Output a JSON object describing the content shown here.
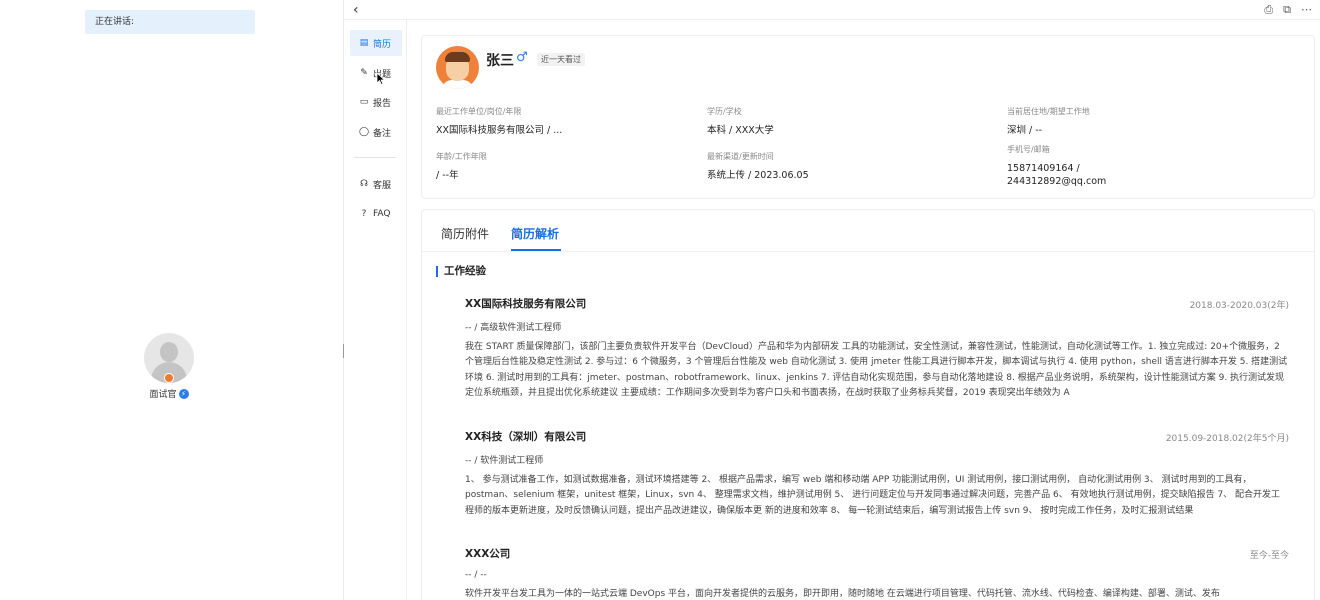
{
  "left_panel": {
    "speaking_label": "正在讲话:",
    "interviewer_label": "面试官",
    "role_badge": "⚡"
  },
  "topbar": {
    "back_icon": "‹",
    "actions": [
      "⎙",
      "⧉",
      "⋯"
    ]
  },
  "nav": {
    "items": [
      {
        "label": "简历",
        "icon": "▤"
      },
      {
        "label": "出题",
        "icon": "✎"
      },
      {
        "label": "报告",
        "icon": "▭"
      },
      {
        "label": "备注",
        "icon": "◯"
      },
      {
        "label": "客服",
        "icon": "☊"
      },
      {
        "label": "FAQ",
        "icon": "?"
      }
    ]
  },
  "candidate": {
    "name": "张三",
    "gender_icon": "♂",
    "seen_badge": "近一天看过",
    "fields": [
      {
        "label": "最近工作单位/岗位/年限",
        "value": "XX国际科技服务有限公司 / ..."
      },
      {
        "label": "学历/学校",
        "value": "本科 / XXX大学"
      },
      {
        "label": "当前居住地/期望工作地",
        "value": "深圳 / --"
      },
      {
        "label": "年龄/工作年限",
        "value": "/ --年"
      },
      {
        "label": "最新渠道/更新时间",
        "value": "系统上传 / 2023.06.05"
      },
      {
        "label": "手机号/邮箱",
        "value": "15871409164 /",
        "value2": "244312892@qq.com"
      }
    ]
  },
  "resume": {
    "tabs": [
      "简历附件",
      "简历解析"
    ],
    "section_title": "工作经验",
    "jobs": [
      {
        "company": "XX国际科技服务有限公司",
        "period": "2018.03-2020.03(2年)",
        "role": "-- / 高级软件测试工程师",
        "desc": "我在 START 质量保障部门，该部门主要负责软件开发平台（DevCloud）产品和华为内部研发 工具的功能测试，安全性测试，兼容性测试，性能测试，自动化测试等工作。1. 独立完成过: 20+个微服务，2 个管理后台性能及稳定性测试 2. 参与过：6 个微服务，3 个管理后台性能及 web 自动化测试 3. 使用 jmeter 性能工具进行脚本开发，脚本调试与执行 4. 使用 python，shell 语言进行脚本开发 5. 搭建测试环境 6. 测试时用到的工具有：jmeter、postman、robotframework、linux、jenkins 7. 评估自动化实现范围，参与自动化落地建设 8. 根据产品业务说明，系统架构，设计性能测试方案 9. 执行测试发现定位系统瓶颈，并且提出优化系统建议 主要成绩：工作期间多次受到华为客户口头和书面表扬，在战时获取了业务标兵奖督，2019 表现突出年绩效为 A"
      },
      {
        "company": "XX科技（深圳）有限公司",
        "period": "2015.09-2018.02(2年5个月)",
        "role": "-- / 软件测试工程师",
        "desc": "1、 参与测试准备工作，如测试数据准备，测试环境搭建等 2、 根据产品需求，编写 web 端和移动端 APP 功能测试用例，UI 测试用例，接口测试用例， 自动化测试用例 3、 测试时用到的工具有，postman、selenium 框架，unitest 框架，Linux，svn 4、 整理需求文档，维护测试用例 5、 进行问题定位与开发同事通过解决问题，完善产品 6、 有效地执行测试用例，提交缺陷报告 7、 配合开发工程师的版本更新进度，及时反馈确认问题，提出产品改进建议，确保版本更 新的进度和效率 8、 每一轮测试结束后，编写测试报告上传 svn 9、 按时完成工作任务，及时汇报测试结果"
      },
      {
        "company": "XXX公司",
        "period": "至今-至今",
        "role": "-- / --",
        "desc": "软件开发平台发工具为一体的一站式云端 DevOps 平台，面向开发者提供的云服务，即开即用，随时随地 在云端进行项目管理、代码托管、流水线、代码检查、编译构建、部署、测试、发布"
      }
    ]
  },
  "colors": {
    "accent": "#1a6fe0",
    "nav_active_bg": "#e8f1fc",
    "speaking_bg": "#e4f0fc",
    "avatar_orange": "#f0813a"
  }
}
